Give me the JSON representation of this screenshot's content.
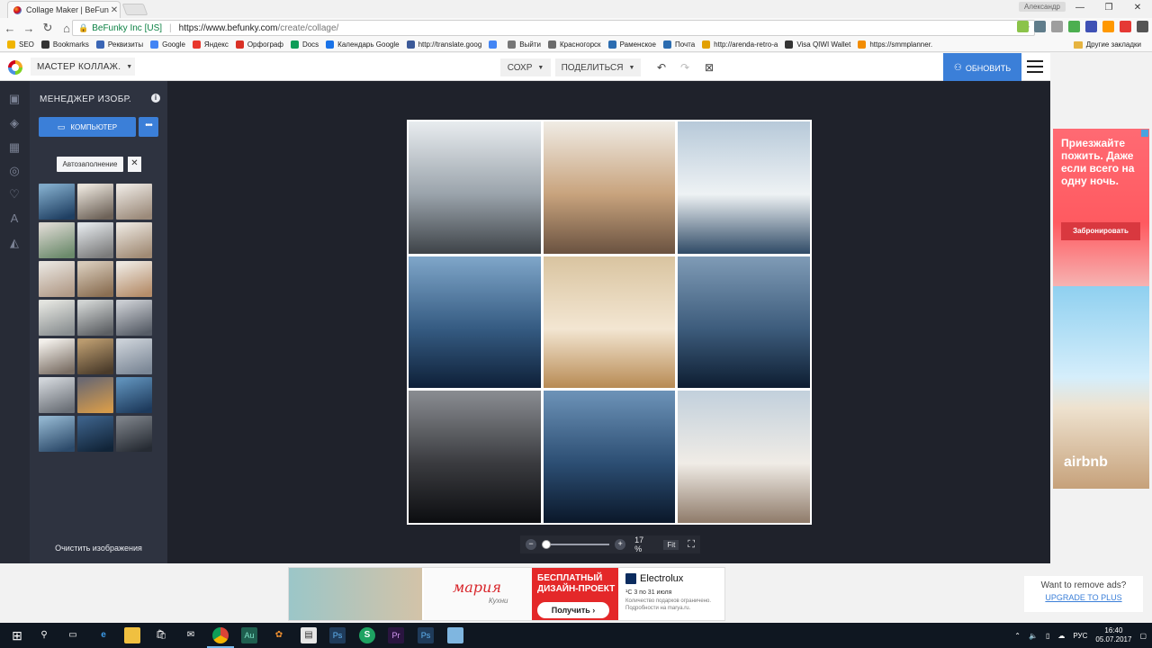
{
  "browser": {
    "tab_title": "Collage Maker | BeFunky",
    "tab_close": "✕",
    "user": "Александр",
    "secure_label": "BeFunky Inc [US]",
    "url_host": "https://www.befunky.com",
    "url_path": "/create/collage/",
    "bookmarks": [
      "SEO",
      "Bookmarks",
      "Реквизиты",
      "Google",
      "Яндекс",
      "Орфограф",
      "Docs",
      "Календарь Google",
      "http://translate.goog",
      "",
      "Выйти",
      "Красногорск",
      "Раменское",
      "Почта",
      "http://arenda-retro-a",
      "Visa QIWI Wallet",
      "https://smmplanner."
    ],
    "bookmark_colors": [
      "#f0b400",
      "#333333",
      "#3b66b5",
      "#4285f4",
      "#e8372c",
      "#d93025",
      "#0f9d58",
      "#1a73e8",
      "#3b5998",
      "#4285f4",
      "#777777",
      "#6c6c6c",
      "#2b6cb0",
      "#2b6cb0",
      "#e2a000",
      "#333333",
      "#f28c00",
      "#2f80ed"
    ],
    "other_bookmarks": "Другие закладки"
  },
  "toolbar": {
    "master": "МАСТЕР КОЛЛАЖ.",
    "save": "СОХР",
    "share": "ПОДЕЛИТЬСЯ",
    "upgrade": "ОБНОВИТЬ",
    "undo_icon": "undo-icon",
    "redo_icon": "redo-icon",
    "close_icon": "close-icon"
  },
  "sidebar": {
    "title": "МЕНЕДЖЕР ИЗОБР.",
    "info": "i",
    "computer_button": "КОМПЬЮТЕР",
    "more": "•••",
    "autofill": "Автозаполнение",
    "autofill_close": "✕",
    "clear": "Очистить изображения",
    "thumbnails": [
      [
        "#7fa9c8",
        "#1f3f62"
      ],
      [
        "#e7e1d8",
        "#6d6258"
      ],
      [
        "#e9e4de",
        "#9b8a7a"
      ],
      [
        "#d9d6cf",
        "#6b8a6b"
      ],
      [
        "#dfe3e6",
        "#7a7a7a"
      ],
      [
        "#e8e2da",
        "#a08a74"
      ],
      [
        "#e6e2dc",
        "#b29b88"
      ],
      [
        "#d6c9b8",
        "#8a6e52"
      ],
      [
        "#ece6de",
        "#b58d6a"
      ],
      [
        "#e2e3de",
        "#8a8f91"
      ],
      [
        "#cfd2d1",
        "#5c5f63"
      ],
      [
        "#c8cbd0",
        "#565c66"
      ],
      [
        "#f2efea",
        "#7a6e64"
      ],
      [
        "#b99a6e",
        "#4a3b2a"
      ],
      [
        "#c9cfd6",
        "#7b8796"
      ],
      [
        "#cfd3d8",
        "#6a6f76"
      ],
      [
        "#6e6a70",
        "#d49a4b"
      ],
      [
        "#5e8fb8",
        "#1d3a5c"
      ],
      [
        "#8fb2cc",
        "#2c4a6a"
      ],
      [
        "#3b5f86",
        "#112438"
      ],
      [
        "#7a7f86",
        "#262b33"
      ]
    ]
  },
  "rail_icons": [
    "image-icon",
    "brush-icon",
    "layout-icon",
    "badge-icon",
    "heart-icon",
    "text-icon",
    "eraser-icon"
  ],
  "collage": {
    "cells": [
      {
        "name": "photo-couple-watch",
        "bg": [
          "#e8ecef",
          "#9aa3ab",
          "#3e4348"
        ]
      },
      {
        "name": "photo-bouquet-hands",
        "bg": [
          "#f0ece5",
          "#c8a37d",
          "#6a5240"
        ]
      },
      {
        "name": "photo-couple-yacht",
        "bg": [
          "#b7c9d9",
          "#eef2f4",
          "#2f4a66"
        ]
      },
      {
        "name": "photo-sailboat-sea",
        "bg": [
          "#7fa6c9",
          "#355b82",
          "#0e2038"
        ]
      },
      {
        "name": "photo-woman-hat",
        "bg": [
          "#d9c4a0",
          "#f3e6d2",
          "#b88b54"
        ]
      },
      {
        "name": "photo-yacht-sea",
        "bg": [
          "#7f9bb6",
          "#3d5c7c",
          "#0d1d31"
        ]
      },
      {
        "name": "photo-sunset-sailboat",
        "bg": [
          "#8a8d92",
          "#3a3b3f",
          "#0c0d10"
        ]
      },
      {
        "name": "photo-yacht-evening",
        "bg": [
          "#6d93b8",
          "#2c4e73",
          "#0a1729"
        ]
      },
      {
        "name": "photo-bouquet-feet",
        "bg": [
          "#c2d0dc",
          "#f0ece6",
          "#8f7b6a"
        ]
      }
    ]
  },
  "zoom": {
    "minus": "−",
    "plus": "+",
    "value": "17 %",
    "level": 0.0,
    "fit": "Fit"
  },
  "ad_right": {
    "text": "Приезжайте пожить. Даже если всего на одну ночь.",
    "button": "Забронировать",
    "brand": "airbnb"
  },
  "ad_bottom": {
    "maria": "мария",
    "maria_sub": "Кухни",
    "free": "БЕСПЛАТНЫЙ ДИЗАЙН-ПРОЕКТ",
    "get": "Получить ›",
    "electrolux": "Electrolux",
    "dates": "¹С 3 по 31 июля",
    "small": "Количество подарков ограничено. Подробности на marya.ru."
  },
  "remove_ads": {
    "question": "Want to remove ads?",
    "link": "UPGRADE TO PLUS"
  },
  "taskbar": {
    "lang": "РУС",
    "time": "16:40",
    "date": "05.07.2017",
    "apps": [
      "search-icon",
      "task-view-icon",
      "edge-icon",
      "explorer-icon",
      "store-icon",
      "mail-icon",
      "chrome-icon",
      "audition-icon",
      "game-icon",
      "notes-icon",
      "photoshop-icon",
      "skype-icon",
      "premiere-icon",
      "photoshop2-icon",
      "app-icon"
    ]
  }
}
